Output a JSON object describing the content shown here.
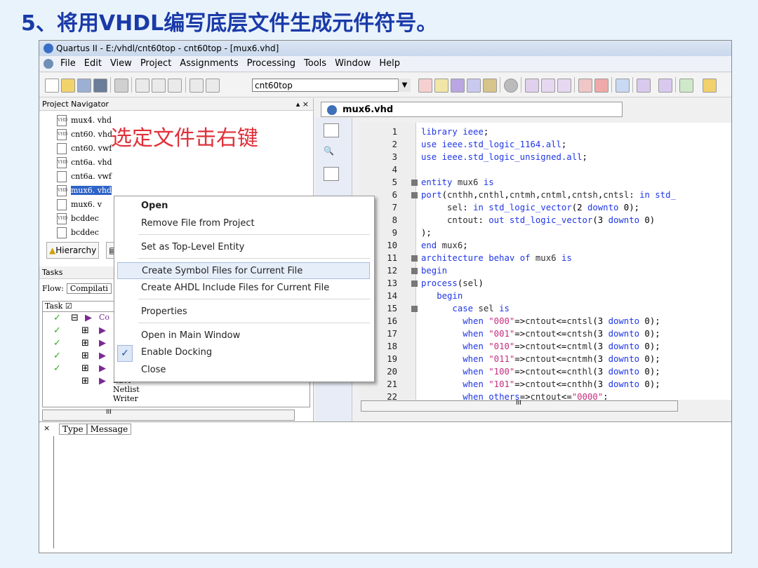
{
  "slide": {
    "title": "5、将用VHDL编写底层文件生成元件符号。",
    "annotation": "选定文件击右键"
  },
  "window": {
    "title": "Quartus II - E:/vhdl/cnt60top - cnt60top - [mux6.vhd]",
    "menu": [
      "File",
      "Edit",
      "View",
      "Project",
      "Assignments",
      "Processing",
      "Tools",
      "Window",
      "Help"
    ],
    "toolbar": {
      "project_combo": "cnt60top"
    }
  },
  "project_navigator": {
    "title": "Project Navigator",
    "files": [
      {
        "name": "mux4. vhd",
        "type": "vhd"
      },
      {
        "name": "cnt60. vhd",
        "type": "vhd"
      },
      {
        "name": "cnt60. vwf",
        "type": "vwf"
      },
      {
        "name": "cnt6a. vhd",
        "type": "vhd"
      },
      {
        "name": "cnt6a. vwf",
        "type": "vwf"
      },
      {
        "name": "mux6. vhd",
        "type": "vhd",
        "selected": true
      },
      {
        "name": "mux6. v",
        "type": "vwf"
      },
      {
        "name": "bcddec",
        "type": "vhd"
      },
      {
        "name": "bcddec",
        "type": "vwf"
      }
    ],
    "tabs": [
      "Hierarchy"
    ]
  },
  "tasks": {
    "title": "Tasks",
    "flow_label": "Flow:",
    "flow_value": "Compilati",
    "column": "Task",
    "rows": [
      "Co",
      "",
      "",
      "",
      ""
    ],
    "last_row": "EDA Netlist Writer",
    "scroll_label": "III"
  },
  "context_menu": {
    "items": [
      {
        "label": "Open",
        "bold": true
      },
      {
        "label": "Remove File from Project"
      },
      {
        "label": "Set as Top-Level Entity"
      },
      {
        "label": "Create Symbol Files for Current File",
        "highlighted": true
      },
      {
        "label": "Create AHDL Include Files for Current File"
      },
      {
        "label": "Properties"
      },
      {
        "label": "Open in Main Window"
      },
      {
        "label": "Enable Docking",
        "checked": true
      },
      {
        "label": "Close"
      }
    ]
  },
  "editor": {
    "tab": "mux6.vhd",
    "scroll_label": "III",
    "lines": [
      {
        "n": "1",
        "code": "library ieee;"
      },
      {
        "n": "2",
        "code": "use ieee.std_logic_1164.all;"
      },
      {
        "n": "3",
        "code": "use ieee.std_logic_unsigned.all;"
      },
      {
        "n": "4",
        "code": ""
      },
      {
        "n": "5",
        "code": "entity mux6 is"
      },
      {
        "n": "6",
        "code": "port(cnthh,cnthl,cntmh,cntml,cntsh,cntsl: in std_"
      },
      {
        "n": "7",
        "code": "     sel: in std_logic_vector(2 downto 0);"
      },
      {
        "n": "8",
        "code": "     cntout: out std_logic_vector(3 downto 0)"
      },
      {
        "n": "9",
        "code": ");"
      },
      {
        "n": "10",
        "code": "end mux6;"
      },
      {
        "n": "11",
        "code": "architecture behav of mux6 is"
      },
      {
        "n": "12",
        "code": "begin"
      },
      {
        "n": "13",
        "code": "process(sel)"
      },
      {
        "n": "14",
        "code": "   begin"
      },
      {
        "n": "15",
        "code": "      case sel is"
      },
      {
        "n": "16",
        "code": "        when \"000\"=>cntout<=cntsl(3 downto 0);"
      },
      {
        "n": "17",
        "code": "        when \"001\"=>cntout<=cntsh(3 downto 0);"
      },
      {
        "n": "18",
        "code": "        when \"010\"=>cntout<=cntml(3 downto 0);"
      },
      {
        "n": "19",
        "code": "        when \"011\"=>cntout<=cntmh(3 downto 0);"
      },
      {
        "n": "20",
        "code": "        when \"100\"=>cntout<=cnthl(3 downto 0);"
      },
      {
        "n": "21",
        "code": "        when \"101\"=>cntout<=cnthh(3 downto 0);"
      },
      {
        "n": "22",
        "code": "        when others=>cntout<=\"0000\";"
      }
    ]
  },
  "messages": {
    "columns": [
      "Type",
      "Message"
    ]
  }
}
